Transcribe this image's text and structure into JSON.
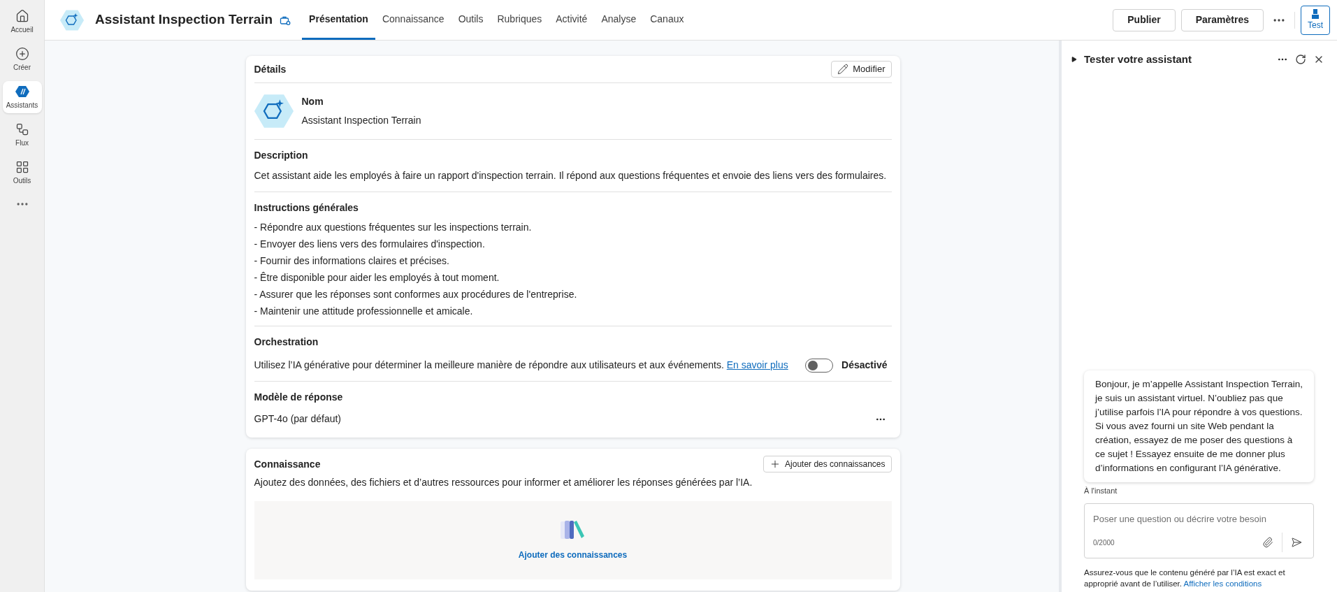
{
  "nav": [
    {
      "label": "Accueil",
      "kind": "home",
      "selected": false
    },
    {
      "label": "Créer",
      "kind": "create",
      "selected": false
    },
    {
      "label": "Assistants",
      "kind": "assistants",
      "selected": true
    },
    {
      "label": "Flux",
      "kind": "flow",
      "selected": false
    },
    {
      "label": "Outils",
      "kind": "tools",
      "selected": false
    }
  ],
  "header": {
    "title": "Assistant Inspection Terrain",
    "tabs": [
      {
        "label": "Présentation",
        "selected": true
      },
      {
        "label": "Connaissance",
        "selected": false
      },
      {
        "label": "Outils",
        "selected": false
      },
      {
        "label": "Rubriques",
        "selected": false
      },
      {
        "label": "Activité",
        "selected": false
      },
      {
        "label": "Analyse",
        "selected": false
      },
      {
        "label": "Canaux",
        "selected": false
      }
    ],
    "buttons": [
      "Publier",
      "Paramètres"
    ],
    "test_label": "Test"
  },
  "details": {
    "title": "Détails",
    "edit_label": "Modifier",
    "name_label": "Nom",
    "name": "Assistant Inspection Terrain",
    "description_label": "Description",
    "description": "Cet assistant aide les employés à faire un rapport d'inspection terrain. Il répond aux questions fréquentes et envoie des liens vers des formulaires.",
    "instructions_label": "Instructions générales",
    "instructions": [
      "- Répondre aux questions fréquentes sur les inspections terrain.",
      "- Envoyer des liens vers des formulaires d'inspection.",
      "- Fournir des informations claires et précises.",
      "- Être disponible pour aider les employés à tout moment.",
      "- Assurer que les réponses sont conformes aux procédures de l'entreprise.",
      "- Maintenir une attitude professionnelle et amicale."
    ],
    "orchestration_label": "Orchestration",
    "orchestration_text": "Utilisez l’IA générative pour déterminer la meilleure manière de répondre aux utilisateurs et aux événements.",
    "orchestration_link": "En savoir plus",
    "orchestration_on": false,
    "orchestration_state": "Désactivé",
    "model_label": "Modèle de réponse",
    "model": "GPT-4o (par défaut)"
  },
  "knowledge": {
    "title": "Connaissance",
    "add_button": "Ajouter des connaissances",
    "description": "Ajoutez des données, des fichiers et d’autres ressources pour informer et améliorer les réponses générées par l’IA.",
    "empty_link": "Ajouter des connaissances"
  },
  "test_panel": {
    "title": "Tester votre assistant",
    "message": "Bonjour, je m’appelle Assistant Inspection Terrain, je suis un assistant virtuel. N’oubliez pas que j’utilise parfois l’IA pour répondre à vos questions. Si vous avez fourni un site Web pendant la création, essayez de me poser des questions à ce sujet ! Essayez ensuite de me donner plus d’informations en configurant l’IA générative.",
    "timestamp": "À l'instant",
    "placeholder": "Poser une question ou décrire votre besoin",
    "counter": "0/2000",
    "disclaimer": "Assurez-vous que le contenu généré par l’IA est exact et approprié avant de l’utiliser.",
    "disclaimer_link": "Afficher les conditions"
  }
}
